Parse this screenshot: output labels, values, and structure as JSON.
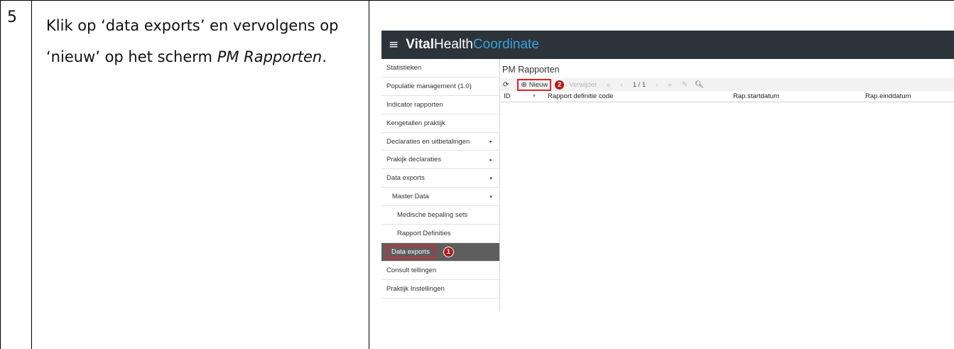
{
  "doc": {
    "step_number": "5",
    "instruction_part1": "Klik op ‘data exports’ en vervolgens op ‘nieuw’ op het scherm ",
    "instruction_em": "PM Rapporten",
    "instruction_part2": "."
  },
  "app": {
    "brand_part1": "Vital",
    "brand_part2": "Health",
    "brand_part3": "Coordinate",
    "header_color": "#2d3439",
    "accent_color": "#3aa0d8",
    "highlight_color": "#d9272e",
    "marker_color": "#b21b1e"
  },
  "sidebar": {
    "items": [
      {
        "label": "Statistieken"
      },
      {
        "label": "Populatie management (1.0)"
      },
      {
        "label": "Indicator rapporten"
      },
      {
        "label": "Kengetallen praktijk"
      },
      {
        "label": "Declaraties en uitbetalingen",
        "arrow": "▸"
      },
      {
        "label": "Prakijk declaraties",
        "arrow": "▸"
      },
      {
        "label": "Data exports",
        "arrow": "▾"
      },
      {
        "label": "Master Data",
        "arrow": "▾"
      },
      {
        "label": "Medische bepaling sets"
      },
      {
        "label": "Rapport Definities"
      },
      {
        "label": "Data exports",
        "marker": "1"
      },
      {
        "label": "Consult tellingen"
      },
      {
        "label": "Praktijk Instellingen"
      }
    ]
  },
  "main": {
    "title": "PM Rapporten",
    "toolbar": {
      "refresh_icon": "refresh-icon",
      "new_label": "Nieuw",
      "new_marker": "2",
      "delete_label": "Verwijder",
      "page_info": "1 / 1",
      "first_glyph": "«",
      "prev_glyph": "‹",
      "next_glyph": "›",
      "last_glyph": "»"
    },
    "columns": [
      "ID",
      "Rapport definitie code",
      "Rap.startdatum",
      "Rap.einddatum"
    ],
    "rows": []
  }
}
